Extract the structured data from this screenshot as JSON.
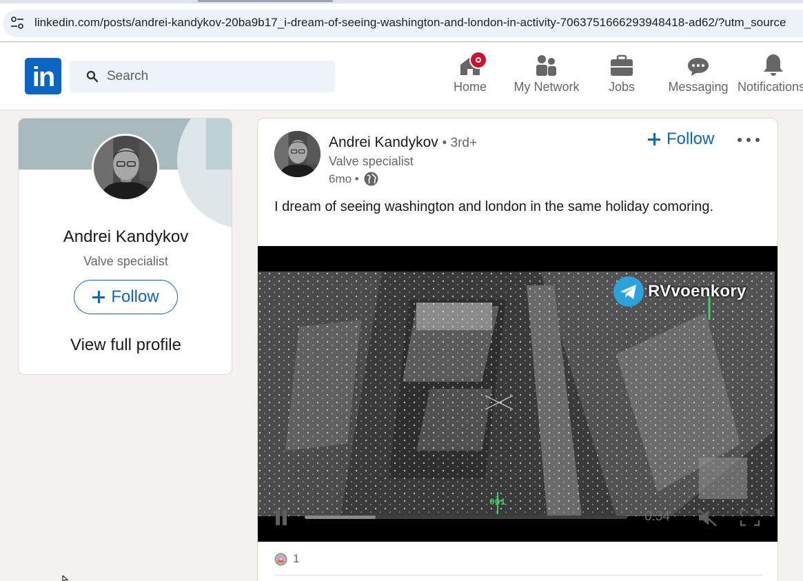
{
  "browser": {
    "url": "linkedin.com/posts/andrei-kandykov-20ba9b17_i-dream-of-seeing-washington-and-london-in-activity-7063751666293948418-ad62/?utm_source"
  },
  "header": {
    "logo": "in",
    "search_placeholder": "Search",
    "nav": [
      {
        "label": "Home",
        "icon": "home-icon",
        "has_badge": true
      },
      {
        "label": "My Network",
        "icon": "network-icon"
      },
      {
        "label": "Jobs",
        "icon": "briefcase-icon"
      },
      {
        "label": "Messaging",
        "icon": "chat-icon"
      },
      {
        "label": "Notifications",
        "icon": "bell-icon"
      }
    ]
  },
  "profile_card": {
    "name": "Andrei Kandykov",
    "headline": "Valve specialist",
    "follow_label": "Follow",
    "view_profile_label": "View full profile"
  },
  "post": {
    "author": "Andrei Kandykov",
    "connection_degree": "• 3rd+",
    "headline": "Valve specialist",
    "time": "6mo •",
    "follow_label": "Follow",
    "text": "I dream of seeing washington and london in the same holiday comoring.",
    "video": {
      "watermark": "RVvoenkory",
      "overlay_counter": "001",
      "timecode": "0:34",
      "progress": 0.22
    },
    "reaction_count": "1"
  },
  "colors": {
    "brand": "#0a66c2",
    "badge": "#cb112d",
    "background": "#f4f2ee"
  }
}
